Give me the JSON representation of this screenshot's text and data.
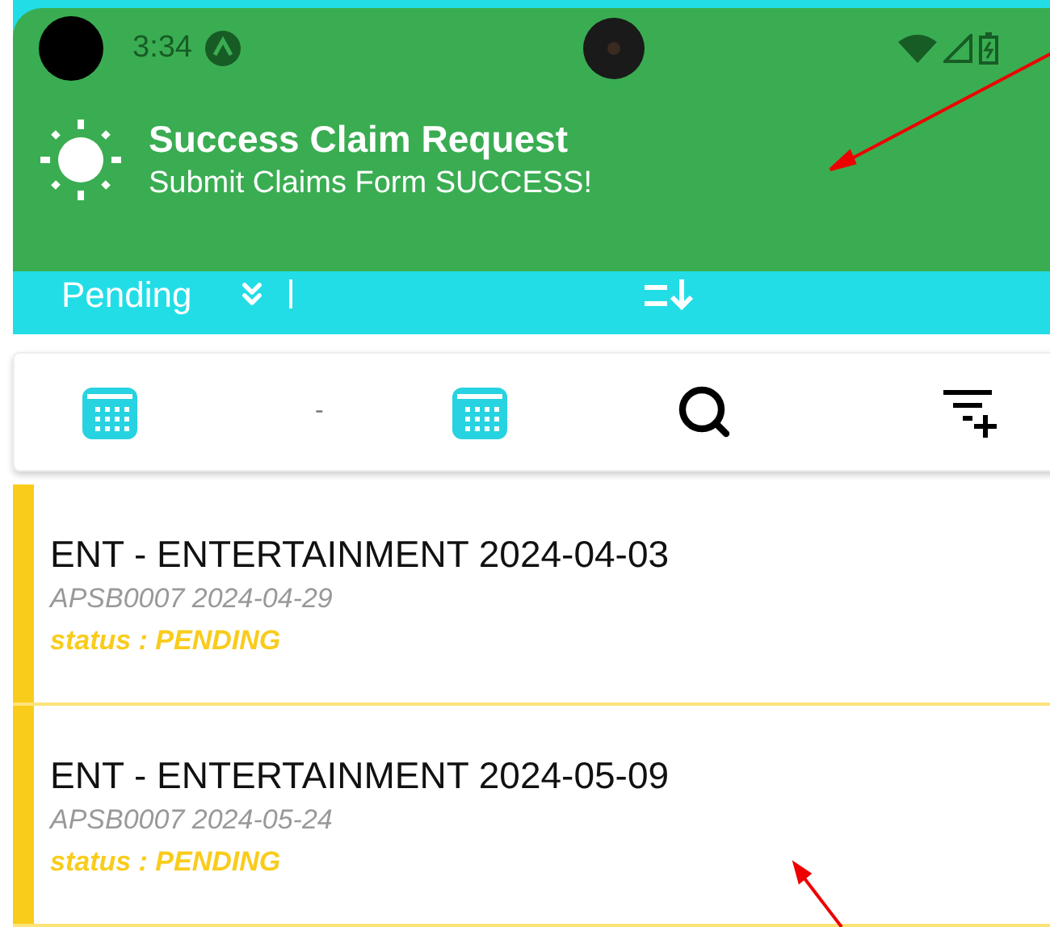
{
  "status_bar": {
    "time": "3:34"
  },
  "notification": {
    "title": "Success Claim Request",
    "message": "Submit Claims Form SUCCESS!"
  },
  "filter_bar": {
    "status": "Pending"
  },
  "date_range": {
    "separator": "-"
  },
  "claims": [
    {
      "title": "ENT - ENTERTAINMENT 2024-04-03",
      "subtitle": "APSB0007 2024-04-29",
      "status": "status : PENDING"
    },
    {
      "title": "ENT - ENTERTAINMENT 2024-05-09",
      "subtitle": "APSB0007 2024-05-24",
      "status": "status : PENDING"
    }
  ]
}
